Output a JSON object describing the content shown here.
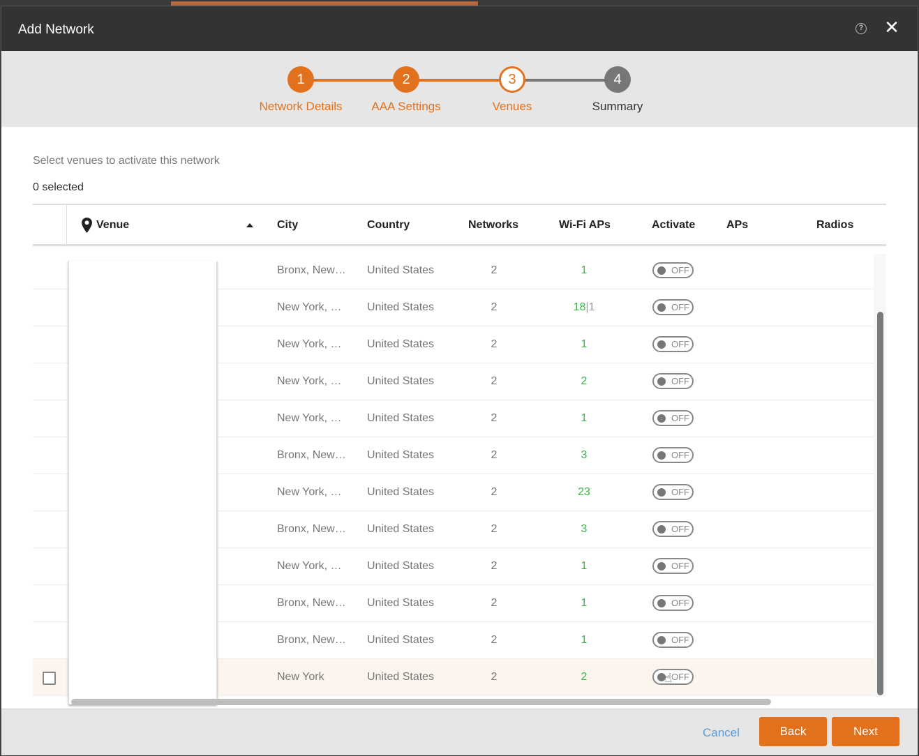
{
  "window": {
    "title": "Add Network",
    "help_icon": "help-circle-icon",
    "close_icon": "close-icon"
  },
  "stepper": {
    "steps": [
      {
        "number": "1",
        "label": "Network Details",
        "state": "done"
      },
      {
        "number": "2",
        "label": "AAA Settings",
        "state": "done"
      },
      {
        "number": "3",
        "label": "Venues",
        "state": "current"
      },
      {
        "number": "4",
        "label": "Summary",
        "state": "todo"
      }
    ]
  },
  "content": {
    "instructions": "Select venues to activate this network",
    "selected_count": "0 selected"
  },
  "table": {
    "columns": {
      "venue": "Venue",
      "city": "City",
      "country": "Country",
      "networks": "Networks",
      "wifi_aps": "Wi-Fi APs",
      "activate": "Activate",
      "aps": "APs",
      "radios": "Radios"
    },
    "sort": {
      "column": "venue",
      "direction": "ascending"
    },
    "rows": [
      {
        "city": "Bronx, New…",
        "country": "United States",
        "networks": "2",
        "wifi_aps": "1",
        "wifi_aps_extra": "",
        "activate": "OFF"
      },
      {
        "city": "New York, …",
        "country": "United States",
        "networks": "2",
        "wifi_aps": "18",
        "wifi_aps_extra": "1",
        "activate": "OFF"
      },
      {
        "city": "New York, …",
        "country": "United States",
        "networks": "2",
        "wifi_aps": "1",
        "wifi_aps_extra": "",
        "activate": "OFF"
      },
      {
        "city": "New York, …",
        "country": "United States",
        "networks": "2",
        "wifi_aps": "2",
        "wifi_aps_extra": "",
        "activate": "OFF"
      },
      {
        "city": "New York, …",
        "country": "United States",
        "networks": "2",
        "wifi_aps": "1",
        "wifi_aps_extra": "",
        "activate": "OFF"
      },
      {
        "city": "Bronx, New…",
        "country": "United States",
        "networks": "2",
        "wifi_aps": "3",
        "wifi_aps_extra": "",
        "activate": "OFF"
      },
      {
        "city": "New York, …",
        "country": "United States",
        "networks": "2",
        "wifi_aps": "23",
        "wifi_aps_extra": "",
        "activate": "OFF"
      },
      {
        "city": "Bronx, New…",
        "country": "United States",
        "networks": "2",
        "wifi_aps": "3",
        "wifi_aps_extra": "",
        "activate": "OFF"
      },
      {
        "city": "New York, …",
        "country": "United States",
        "networks": "2",
        "wifi_aps": "1",
        "wifi_aps_extra": "",
        "activate": "OFF"
      },
      {
        "city": "Bronx, New…",
        "country": "United States",
        "networks": "2",
        "wifi_aps": "1",
        "wifi_aps_extra": "",
        "activate": "OFF"
      },
      {
        "city": "Bronx, New…",
        "country": "United States",
        "networks": "2",
        "wifi_aps": "1",
        "wifi_aps_extra": "",
        "activate": "OFF"
      },
      {
        "city": "New York",
        "country": "United States",
        "networks": "2",
        "wifi_aps": "2",
        "wifi_aps_extra": "",
        "activate": "OFF",
        "hovered": true
      }
    ]
  },
  "footer": {
    "cancel_label": "Cancel",
    "back_label": "Back",
    "next_label": "Next"
  },
  "colors": {
    "accent": "#e2711d",
    "titlebar": "#333333",
    "wifi_green": "#3bb54a",
    "link_blue": "#5b9bd5"
  }
}
